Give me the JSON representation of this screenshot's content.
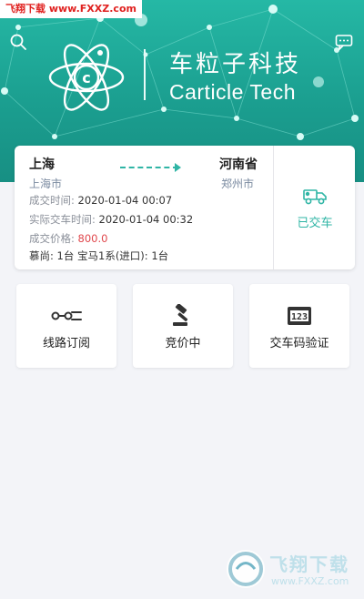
{
  "watermark_top": "飞翔下载 www.FXXZ.com",
  "header": {
    "brand_cn": "车粒子科技",
    "brand_en": "Carticle Tech",
    "brand_color": "#1fa896"
  },
  "order": {
    "from_province": "上海",
    "from_city": "上海市",
    "to_province": "河南省",
    "to_city": "郑州市",
    "deal_time_label": "成交时间:",
    "deal_time": "2020-01-04 00:07",
    "delivery_time_label": "实际交车时间:",
    "delivery_time": "2020-01-04 00:32",
    "price_label": "成交价格:",
    "price": "800.0",
    "vehicles": "慕尚: 1台 宝马1系(进口): 1台",
    "status": "已交车",
    "accent_color": "#2fb5a5",
    "price_color": "#e0464b"
  },
  "menu": [
    {
      "label": "线路订阅",
      "icon": "route-subscribe-icon"
    },
    {
      "label": "竞价中",
      "icon": "auction-gavel-icon"
    },
    {
      "label": "交车码验证",
      "icon": "code-verify-icon"
    }
  ],
  "watermark_bottom": {
    "title": "飞翔下载",
    "url": "www.FXXZ.com"
  }
}
